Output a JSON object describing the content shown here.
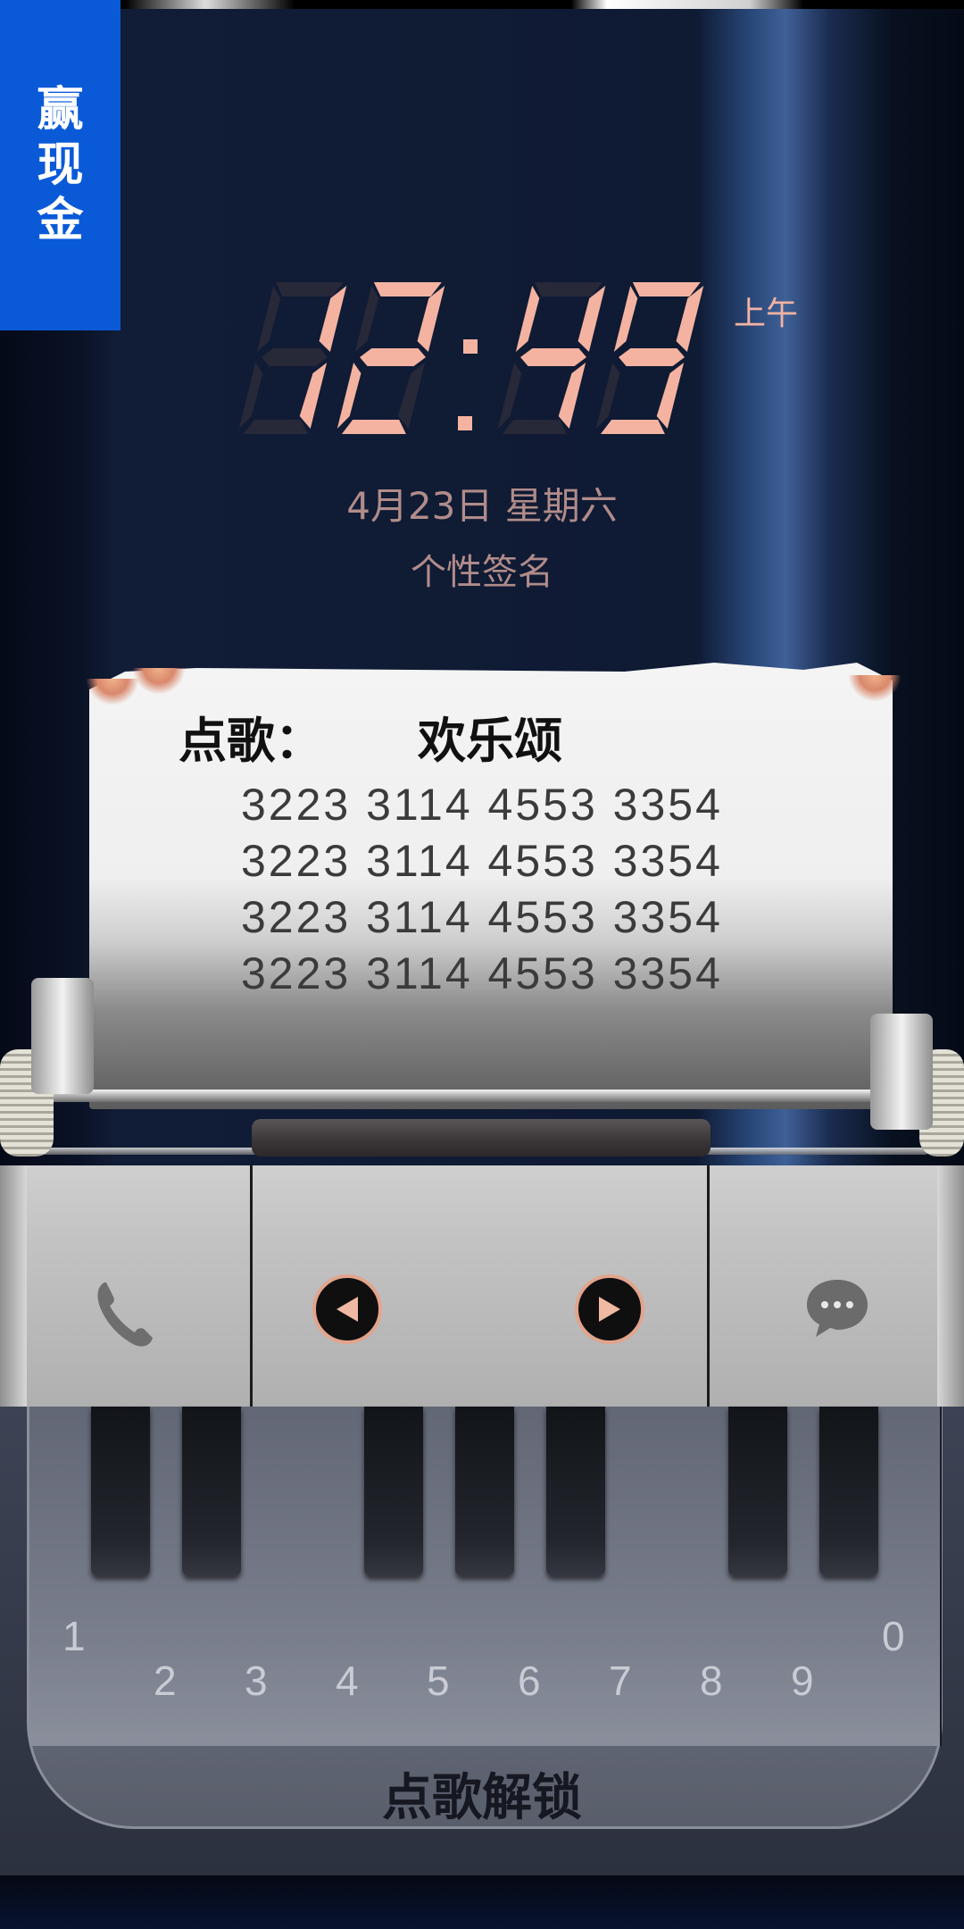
{
  "promo": {
    "label_chars": [
      "赢",
      "现",
      "金"
    ]
  },
  "clock": {
    "time": "12:49",
    "digits": [
      "1",
      "2",
      "4",
      "9"
    ],
    "ampm": "上午",
    "date": "4月23日 星期六",
    "signature": "个性签名",
    "digit_color": "#f4b3a1"
  },
  "paper": {
    "song_label": "点歌：",
    "song_name": "欢乐颂",
    "note_rows": [
      "3223  3114 4553 3354",
      "3223  3114 4553 3354",
      "3223  3114 4553 3354",
      "3223  3114 4553 3354"
    ]
  },
  "controls": {
    "phone_icon": "phone-icon",
    "prev_icon": "play-left-icon",
    "next_icon": "play-right-icon",
    "message_icon": "message-icon",
    "accent": "#e2a48c"
  },
  "keyboard": {
    "key_labels": [
      "1",
      "2",
      "3",
      "4",
      "5",
      "6",
      "7",
      "8",
      "9",
      "0"
    ],
    "unlock_label": "点歌解锁"
  }
}
